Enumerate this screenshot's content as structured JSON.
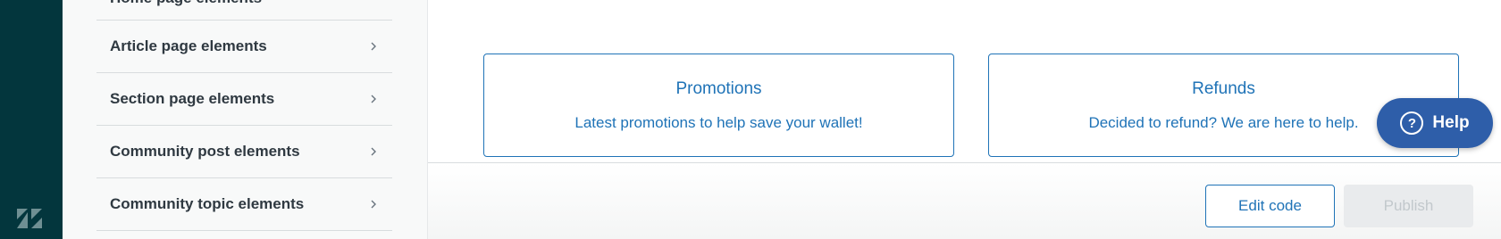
{
  "sidebar": {
    "partial_item_label": "Home page elements",
    "items": [
      {
        "label": "Article page elements"
      },
      {
        "label": "Section page elements"
      },
      {
        "label": "Community post elements"
      },
      {
        "label": "Community topic elements"
      }
    ]
  },
  "preview": {
    "cards": [
      {
        "title": "Promotions",
        "description": "Latest promotions to help save your wallet!"
      },
      {
        "title": "Refunds",
        "description": "Decided to refund? We are here to help."
      }
    ]
  },
  "footer": {
    "edit_code_label": "Edit code",
    "publish_label": "Publish"
  },
  "help_widget": {
    "label": "Help",
    "icon_glyph": "?"
  },
  "colors": {
    "rail": "#03363d",
    "accent": "#1f73b7",
    "help_button": "#2e5ea9"
  },
  "icons": {
    "logo": "zendesk-logo",
    "chevron": "chevron-right-icon"
  }
}
